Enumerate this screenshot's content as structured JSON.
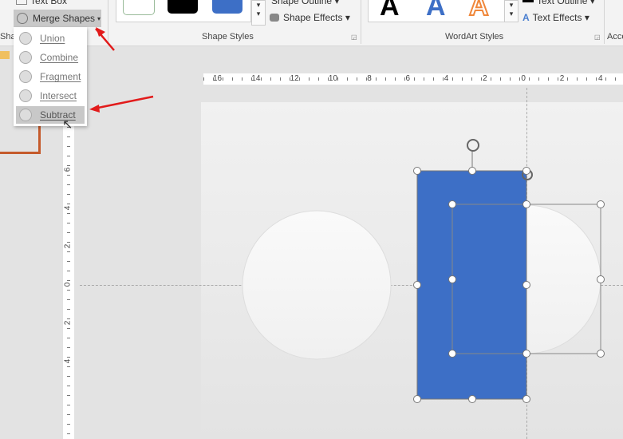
{
  "ribbon": {
    "text_box": "Text Box",
    "merge_shapes": "Merge Shapes",
    "shape_group_partial": "Sha",
    "shape_outline": "Shape Outline",
    "shape_effects": "Shape Effects",
    "shape_styles": "Shape Styles",
    "wordart_letter": "A",
    "text_outline": "Text Outline",
    "text_effects": "Text Effects",
    "wordart_styles": "WordArt Styles",
    "accessibility_partial": "Acce"
  },
  "merge_menu": {
    "items": [
      {
        "label": "Union",
        "icon": "union-icon"
      },
      {
        "label": "Combine",
        "icon": "combine-icon"
      },
      {
        "label": "Fragment",
        "icon": "fragment-icon"
      },
      {
        "label": "Intersect",
        "icon": "intersect-icon"
      },
      {
        "label": "Subtract",
        "icon": "subtract-icon",
        "highlighted": true
      }
    ]
  },
  "rulers": {
    "horizontal": [
      "16",
      "14",
      "12",
      "10",
      "8",
      "6",
      "4",
      "2",
      "0",
      "2",
      "4"
    ],
    "vertical": [
      "6",
      "4",
      "2",
      "0",
      "2",
      "4"
    ]
  },
  "colors": {
    "shape_blue": "#3d6fc6",
    "arrow_red": "#e21b1b",
    "accent_orange": "#c55a2b"
  }
}
